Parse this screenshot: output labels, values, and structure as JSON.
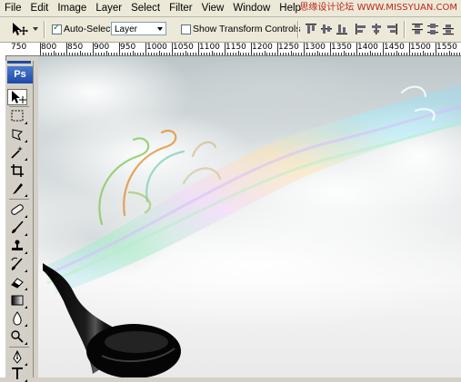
{
  "menu": {
    "items": [
      "File",
      "Edit",
      "Image",
      "Layer",
      "Select",
      "Filter",
      "View",
      "Window",
      "Help"
    ]
  },
  "watermark": "思缘设计论坛 WWW.MISSYUAN.COM",
  "options": {
    "auto_select_label": "Auto-Select:",
    "auto_select_checked": true,
    "auto_select_value": "Layer",
    "show_transform_label": "Show Transform Controls",
    "show_transform_checked": false
  },
  "ruler": {
    "corner_label": "750",
    "labels": [
      "800",
      "850",
      "900",
      "950",
      "1000",
      "1050",
      "1100",
      "1150",
      "1200",
      "1250",
      "1300",
      "1350",
      "1400",
      "1450",
      "1500",
      "1550"
    ]
  },
  "tools": {
    "logo": "Ps",
    "items": [
      "move-tool",
      "marquee-tool",
      "lasso-tool",
      "magic-wand-tool",
      "crop-tool",
      "slice-tool",
      "healing-brush-tool",
      "brush-tool",
      "clone-stamp-tool",
      "history-brush-tool",
      "eraser-tool",
      "gradient-tool",
      "blur-tool",
      "dodge-tool",
      "pen-tool",
      "type-tool"
    ]
  },
  "colors": {
    "chrome": "#ece9d8",
    "ps_blue": "#1d4aa8",
    "watermark": "#c02418"
  }
}
